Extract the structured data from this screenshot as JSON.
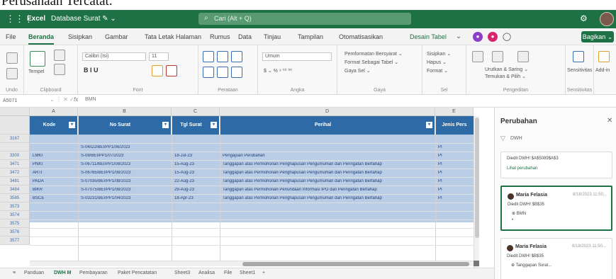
{
  "caption": {
    "text": "Perusahaan Tercatat."
  },
  "titlebar": {
    "app": "Excel",
    "doc": "Database Surat ✎ ⌄",
    "search_placeholder": "Cari (Alt + Q)",
    "icons": {
      "apps": "waffle-icon",
      "search": "search-icon",
      "settings": "gear-icon",
      "user": "avatar"
    }
  },
  "tabs": [
    {
      "label": "File"
    },
    {
      "label": "Beranda",
      "active": true
    },
    {
      "label": "Sisipkan"
    },
    {
      "label": "Gambar"
    },
    {
      "label": "Tata Letak Halaman"
    },
    {
      "label": "Rumus"
    },
    {
      "label": "Data"
    },
    {
      "label": "Tinjau"
    },
    {
      "label": "Tampilan"
    },
    {
      "label": "Otomatisasikan"
    },
    {
      "label": "Desain Tabel"
    }
  ],
  "share": {
    "label": "Bagikan ⌄"
  },
  "ribbon": {
    "groups": [
      "Undo",
      "Clipboard",
      "Font",
      "Perataan",
      "Angka",
      "Gaya",
      "Sel",
      "Pengeditan",
      "Sensitivitas"
    ],
    "font_name": "Calibri (Isi)",
    "font_size": "11",
    "number_format": "Umum",
    "number_controls": "$ ⌄ % ⁹ ⁰⁰ ⁰⁰",
    "styles": [
      "Pemformatan Bersyarat ⌄",
      "Format Sebagai Tabel ⌄",
      "Gaya Sel ⌄"
    ],
    "cells": [
      "Sisipkan ⌄",
      "Hapus ⌄",
      "Format ⌄"
    ],
    "editing": [
      "Urutkan & Saring ⌄",
      "Temukan & Pilih ⌄"
    ],
    "clipboard_paste": "Tempel",
    "font_styles": "B  I  U",
    "sensitivity": "Sensitivitas",
    "addins": "Add-in"
  },
  "formula_bar": {
    "name_box": "A5071",
    "fx": "fx",
    "value": "BMN"
  },
  "sheet": {
    "columns": [
      "A",
      "B",
      "C",
      "D",
      "E"
    ],
    "headers": [
      "Kode",
      "No Surat",
      "Tgl Surat",
      "Perihal",
      "Jenis Pers"
    ],
    "rows": [
      {
        "num": "3167",
        "cells": [
          "",
          "",
          "",
          "",
          ""
        ]
      },
      {
        "num": "",
        "cells": [
          "",
          "S-04/DJ/BEI/PP1/06/2023",
          "",
          "",
          "PI"
        ]
      },
      {
        "num": "3300",
        "cells": [
          "LMKI",
          "S-09/BEI/PP1/07/2023",
          "18-Jul-23",
          "Pengajuan Perubahan",
          "PI"
        ]
      },
      {
        "num": "3471",
        "cells": [
          "PNKI",
          "S-06711/BEI/PP1/08/2023",
          "15-Aug-23",
          "Tanggapan atas Permohonan Penghapusan Pengumuman dan Peringatan Bertahap",
          "PI"
        ]
      },
      {
        "num": "3472",
        "cells": [
          "ARTI",
          "S-06765/BEI/PP1/08/2023",
          "15-Aug-23",
          "Tanggapan atas Permohonan Penghapusan Pengumuman dan Peringatan Bertahap",
          "PI"
        ]
      },
      {
        "num": "3481",
        "cells": [
          "PADA",
          "S-07035/BEI/PP1/08/2023",
          "22-Aug-23",
          "Tanggapan atas Permohonan Penghapusan Pengumuman dan Peringatan Bertahap",
          "PI"
        ]
      },
      {
        "num": "3484",
        "cells": [
          "BIKR",
          "S-07075/BEI/PP1/08/2023",
          "29-Aug-23",
          "Tanggapan atas Permohonan Penundaan Informasi IPO dan Peringatan Bertahap",
          "PI"
        ]
      },
      {
        "num": "3585",
        "cells": [
          "BSCE",
          "S-03231/BEI/PP1/04/2023",
          "18-Apr-23",
          "Tanggapan atas Permohonan Penghapusan Pengumuman dan Peringatan Bertahap",
          "PI"
        ]
      },
      {
        "num": "3573",
        "cells": [
          "",
          "",
          "",
          "",
          ""
        ]
      },
      {
        "num": "3574",
        "cells": [
          "",
          "",
          "",
          "",
          ""
        ]
      },
      {
        "num": "3575",
        "cells": [
          "",
          "",
          "",
          "",
          ""
        ]
      },
      {
        "num": "3576",
        "cells": [
          "",
          "",
          "",
          "",
          ""
        ]
      },
      {
        "num": "3577",
        "cells": [
          "",
          "",
          "",
          "",
          ""
        ]
      }
    ]
  },
  "sheet_tabs": [
    "≡",
    "Panduan",
    "DWH M",
    "Pembayaran",
    "Paket Pencatatan",
    "Sheet3",
    "Analisa",
    "File",
    "Sheet1",
    "+"
  ],
  "panel": {
    "title": "Perubahan",
    "close": "✕",
    "filter_label": "DWH",
    "card0": {
      "line": "Diedit DWH! $A$5089$A$3",
      "link": "Lihat perubahan"
    },
    "card1": {
      "name": "Maria Felasia",
      "time": "8/18/2023 11:50...",
      "line": "Diedit DWH! $B$35",
      "sub1": "⊕  BMN",
      "sub2": "•"
    },
    "card2": {
      "name": "Maria Felasia",
      "time": "8/18/2023 11:50...",
      "line": "Diedit DWH! $B$35",
      "sub1": "⊕  Tanggapan Surat..."
    }
  }
}
